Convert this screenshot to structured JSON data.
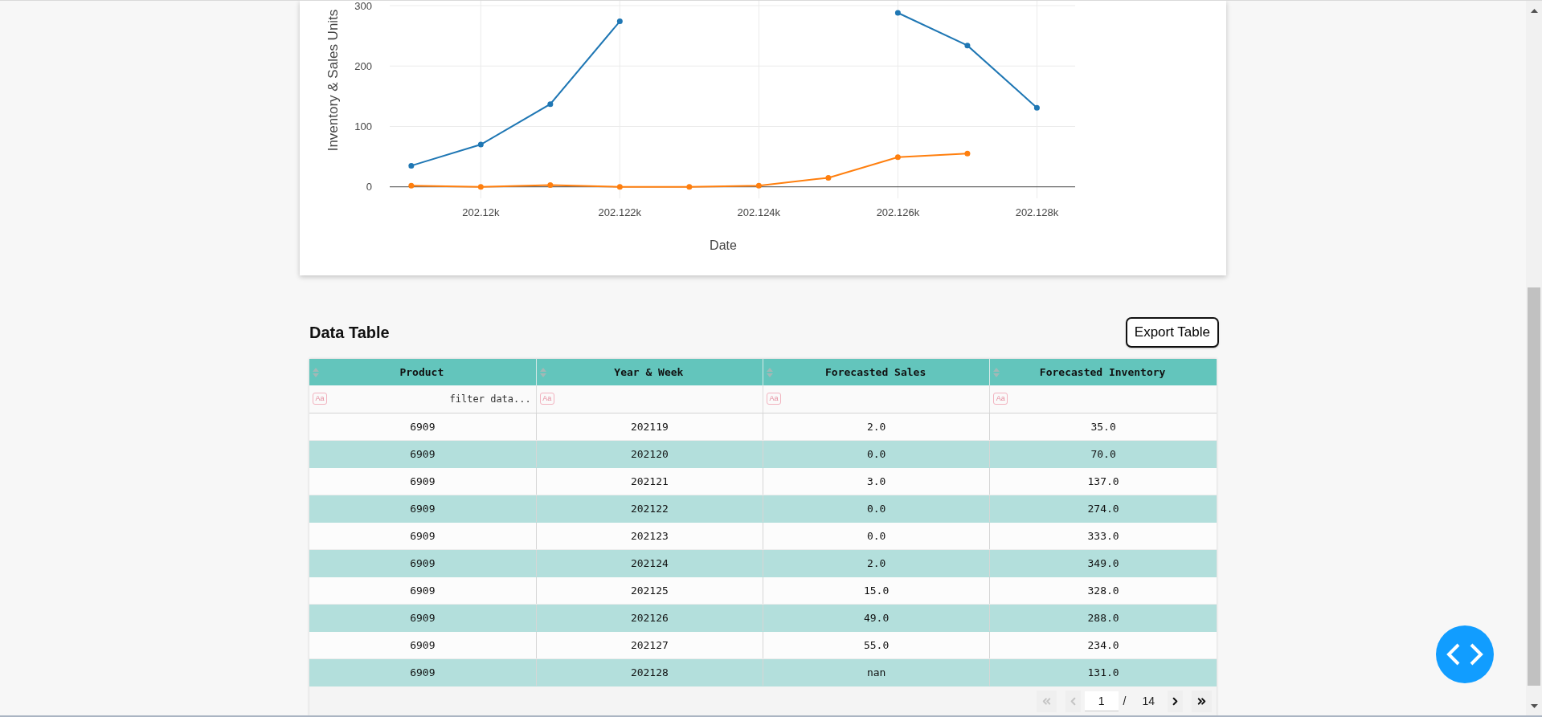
{
  "chart": {
    "chart_data": {
      "type": "line",
      "xlabel": "Date",
      "ylabel": "Inventory & Sales Units",
      "grid": true,
      "x": [
        202119,
        202120,
        202121,
        202122,
        202123,
        202124,
        202125,
        202126,
        202127,
        202128
      ],
      "series": [
        {
          "color": "#1f77b4",
          "marker": true,
          "values": [
            35,
            70,
            137,
            274,
            null,
            null,
            null,
            288,
            234,
            131
          ]
        },
        {
          "color": "#ff7f0e",
          "marker": true,
          "values": [
            2,
            0,
            3,
            0,
            0,
            2,
            15,
            49,
            55,
            null
          ]
        }
      ],
      "xlim": [
        202118.69,
        202128.55
      ],
      "ylim": [
        -19,
        308
      ],
      "xticks": [
        {
          "value": 202120,
          "label": "202.12k"
        },
        {
          "value": 202122,
          "label": "202.122k"
        },
        {
          "value": 202124,
          "label": "202.124k"
        },
        {
          "value": 202126,
          "label": "202.126k"
        },
        {
          "value": 202128,
          "label": "202.128k"
        }
      ],
      "yticks": [
        0,
        100,
        200,
        300
      ]
    }
  },
  "data_table": {
    "title": "Data Table",
    "export_button": "Export Table",
    "columns": [
      "Product",
      "Year & Week",
      "Forecasted Sales",
      "Forecasted Inventory"
    ],
    "filters": [
      {
        "toggle": "Aa",
        "placeholder": "filter data..."
      },
      {
        "toggle": "Aa"
      },
      {
        "toggle": "Aa"
      },
      {
        "toggle": "Aa"
      }
    ],
    "rows": [
      [
        "6909",
        "202119",
        "2.0",
        "35.0"
      ],
      [
        "6909",
        "202120",
        "0.0",
        "70.0"
      ],
      [
        "6909",
        "202121",
        "3.0",
        "137.0"
      ],
      [
        "6909",
        "202122",
        "0.0",
        "274.0"
      ],
      [
        "6909",
        "202123",
        "0.0",
        "333.0"
      ],
      [
        "6909",
        "202124",
        "2.0",
        "349.0"
      ],
      [
        "6909",
        "202125",
        "15.0",
        "328.0"
      ],
      [
        "6909",
        "202126",
        "49.0",
        "288.0"
      ],
      [
        "6909",
        "202127",
        "55.0",
        "234.0"
      ],
      [
        "6909",
        "202128",
        "nan",
        "131.0"
      ]
    ],
    "pagination": {
      "controls": [
        {
          "kind": "first",
          "disabled": true
        },
        {
          "kind": "previous",
          "disabled": true
        },
        {
          "kind": "page_input",
          "value": "1"
        },
        {
          "kind": "separator",
          "text": "/"
        },
        {
          "kind": "page_count",
          "text": "14"
        },
        {
          "kind": "next",
          "disabled": false
        },
        {
          "kind": "last",
          "disabled": false
        }
      ]
    }
  }
}
